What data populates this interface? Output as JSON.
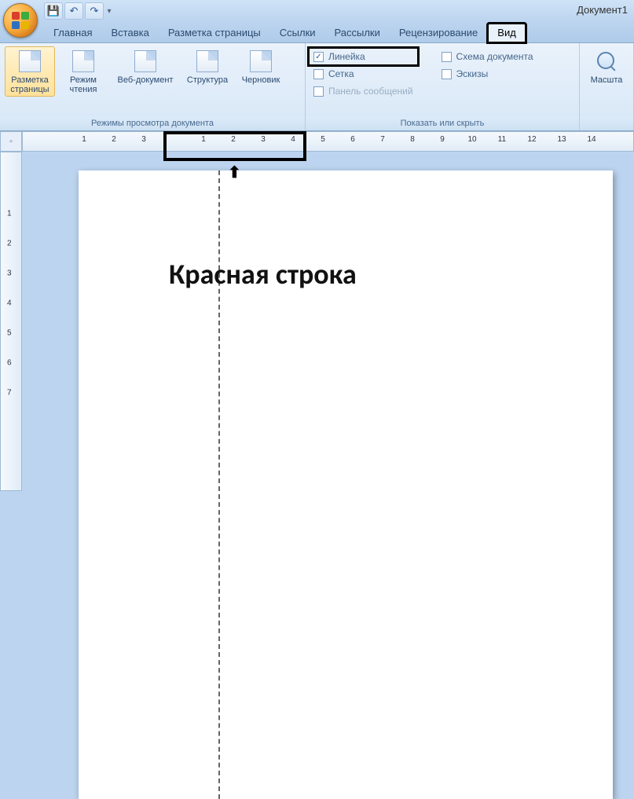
{
  "title_bar": {
    "document_title": "Документ1",
    "qat": {
      "save": "💾",
      "undo": "↶",
      "redo": "↷",
      "more": "▾"
    }
  },
  "tabs": {
    "home": "Главная",
    "insert": "Вставка",
    "page_layout": "Разметка страницы",
    "references": "Ссылки",
    "mailings": "Рассылки",
    "review": "Рецензирование",
    "view": "Вид"
  },
  "ribbon": {
    "views_group": {
      "label": "Режимы просмотра документа",
      "print_layout": "Разметка страницы",
      "reading": "Режим чтения",
      "web": "Веб-документ",
      "outline": "Структура",
      "draft": "Черновик"
    },
    "show_hide_group": {
      "label": "Показать или скрыть",
      "ruler": "Линейка",
      "gridlines": "Сетка",
      "message_bar": "Панель сообщений",
      "doc_map": "Схема документа",
      "thumbnails": "Эскизы"
    },
    "zoom_group": {
      "zoom": "Масшта"
    }
  },
  "ruler": {
    "h_labels_neg": [
      "3",
      "2",
      "1"
    ],
    "h_labels_pos": [
      "1",
      "2",
      "3",
      "4",
      "5",
      "6",
      "7",
      "8",
      "9",
      "10",
      "11",
      "12",
      "13",
      "14"
    ],
    "v_labels": [
      "1",
      "2",
      "3",
      "4",
      "5",
      "6",
      "7"
    ]
  },
  "page": {
    "heading": "Красная строка"
  }
}
